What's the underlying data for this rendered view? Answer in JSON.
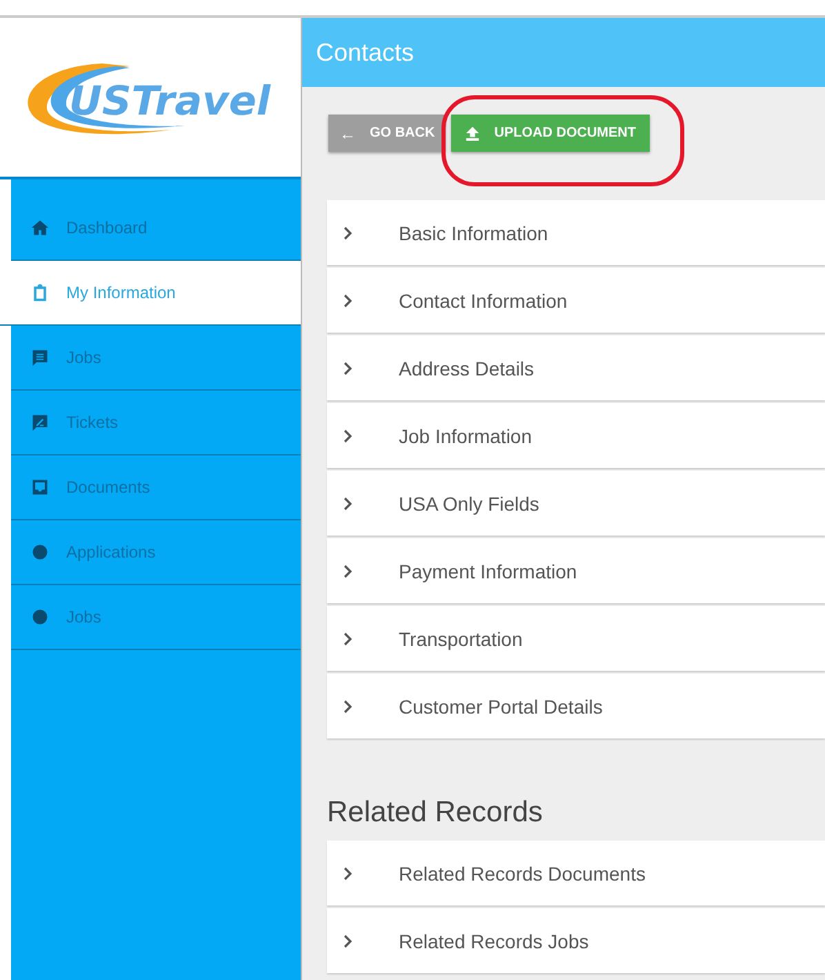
{
  "logo": {
    "text": "USTravel"
  },
  "sidebar": {
    "items": [
      {
        "label": "Dashboard",
        "kind": "home",
        "selected": false
      },
      {
        "label": "My Information",
        "kind": "clipboard",
        "selected": true
      },
      {
        "label": "Jobs",
        "kind": "list",
        "selected": false
      },
      {
        "label": "Tickets",
        "kind": "edit",
        "selected": false
      },
      {
        "label": "Documents",
        "kind": "inbox",
        "selected": false
      },
      {
        "label": "Applications",
        "kind": "dot",
        "selected": false
      },
      {
        "label": "Jobs",
        "kind": "dot",
        "selected": false
      }
    ]
  },
  "header": {
    "title": "Contacts"
  },
  "toolbar": {
    "buttons": [
      {
        "label": "GO BACK",
        "icon": "←",
        "kind": "back"
      },
      {
        "label": "UPLOAD DOCUMENT",
        "kind": "upload",
        "highlighted": true
      }
    ]
  },
  "sections": [
    {
      "label": "Basic Information",
      "expanded": false
    },
    {
      "label": "Contact Information",
      "expanded": false
    },
    {
      "label": "Address Details",
      "expanded": false
    },
    {
      "label": "Job Information",
      "expanded": false
    },
    {
      "label": "USA Only Fields",
      "expanded": false
    },
    {
      "label": "Payment Information",
      "expanded": false
    },
    {
      "label": "Transportation",
      "expanded": false
    },
    {
      "label": "Customer Portal Details",
      "expanded": false
    }
  ],
  "related": {
    "title": "Related Records",
    "sections": [
      {
        "label": "Related Records Documents",
        "expanded": false
      },
      {
        "label": "Related Records Jobs",
        "expanded": false
      }
    ]
  }
}
